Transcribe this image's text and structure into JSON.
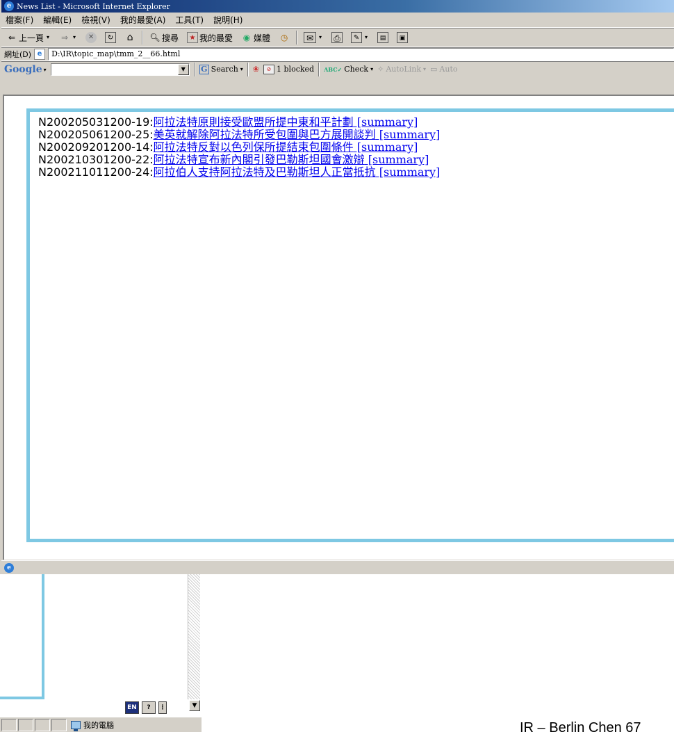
{
  "window": {
    "title": "News List - Microsoft Internet Explorer"
  },
  "menu": [
    "檔案(F)",
    "編輯(E)",
    "檢視(V)",
    "我的最愛(A)",
    "工具(T)",
    "說明(H)"
  ],
  "toolbar": {
    "back_label": "上一頁",
    "search_label": "搜尋",
    "favorites_label": "我的最愛",
    "media_label": "媒體"
  },
  "address": {
    "label": "網址(D)",
    "url": "D:\\IR\\topic_map\\tmm_2__66.html"
  },
  "google_bar": {
    "logo": "Google",
    "search_label": "Search",
    "blocked_label": "1 blocked",
    "check_label": "Check",
    "autolink_label": "AutoLink",
    "autofill_label": "Auto"
  },
  "news": [
    {
      "id": "N200205031200-19:",
      "title": "阿拉法特原則接受歐盟所提中東和平計劃",
      "summary": " [summary]"
    },
    {
      "id": "N200205061200-25:",
      "title": "美英就解除阿拉法特所受包圍與巴方展開談判",
      "summary": " [summary]"
    },
    {
      "id": "N200209201200-14:",
      "title": "阿拉法特反對以色列保所提結束包圍條件",
      "summary": " [summary]"
    },
    {
      "id": "N200210301200-22:",
      "title": "阿拉法特宣布新內閣引發巴勒斯坦國會激辯",
      "summary": " [summary]"
    },
    {
      "id": "N200211011200-24:",
      "title": "阿拉伯人支持阿拉法特及巴勒斯坦人正當抵抗",
      "summary": " [summary]"
    }
  ],
  "taskbar": {
    "lang_label": "EN",
    "help_label": "?",
    "computer_label": "我的電腦"
  },
  "footer": {
    "text": "IR – Berlin Chen 67"
  }
}
